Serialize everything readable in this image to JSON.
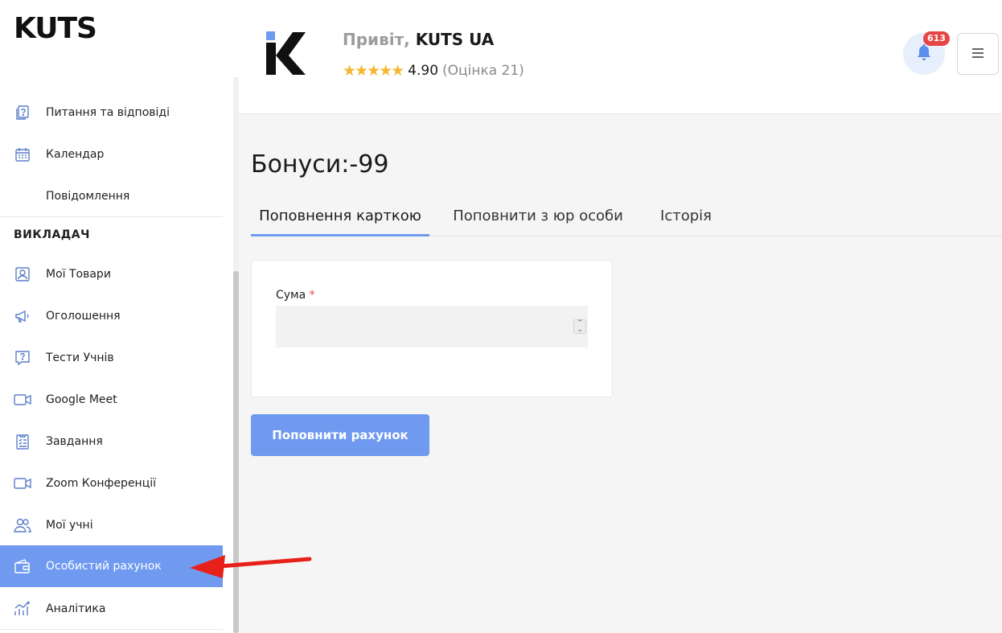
{
  "sidebar": {
    "logo": "KUTS",
    "items": [
      {
        "label": "Питання та відповіді",
        "icon": "question-doc-icon"
      },
      {
        "label": "Календар",
        "icon": "calendar-icon"
      },
      {
        "label": "Повідомлення",
        "icon": ""
      },
      {
        "label": "Мої Товари",
        "icon": "user-card-icon"
      },
      {
        "label": "Оголошення",
        "icon": "megaphone-icon"
      },
      {
        "label": "Тести Учнів",
        "icon": "question-bubble-icon"
      },
      {
        "label": "Google Meet",
        "icon": "video-icon"
      },
      {
        "label": "Завдання",
        "icon": "checklist-icon"
      },
      {
        "label": "Zoom Конференції",
        "icon": "video-icon"
      },
      {
        "label": "Мої учні",
        "icon": "users-icon"
      },
      {
        "label": "Особистий рахунок",
        "icon": "wallet-icon",
        "active": true
      },
      {
        "label": "Аналітика",
        "icon": "analytics-icon"
      }
    ],
    "section_teacher": "ВИКЛАДАЧ"
  },
  "header": {
    "greeting_prefix": "Привіт,",
    "user_name": "KUTS UA",
    "rating_value": "4.90",
    "rating_count": "(Оцінка 21)",
    "rating_stars": 4.9,
    "notification_count": "613"
  },
  "main": {
    "bonus_title": "Бонуси:-99",
    "tabs": [
      {
        "label": "Поповнення карткою",
        "active": true
      },
      {
        "label": "Поповнити з юр особи"
      },
      {
        "label": "Історія"
      }
    ],
    "amount_label": "Сума",
    "required_mark": "*",
    "amount_value": "",
    "submit_label": "Поповнити рахунок"
  },
  "colors": {
    "accent": "#6f9af0",
    "badge": "#e64545",
    "star": "#f5b731",
    "arrow": "#e8201a"
  }
}
